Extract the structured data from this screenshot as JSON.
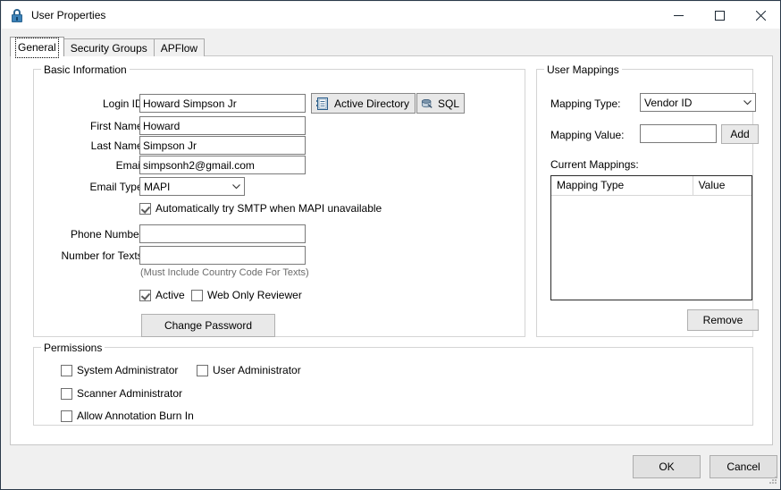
{
  "window": {
    "title": "User Properties",
    "icon": "lock-icon",
    "controls": {
      "minimize": "minimize-icon",
      "maximize": "maximize-icon",
      "close": "close-icon"
    }
  },
  "tabs": [
    {
      "label": "General",
      "selected": true
    },
    {
      "label": "Security Groups",
      "selected": false
    },
    {
      "label": "APFlow",
      "selected": false
    }
  ],
  "basic_information": {
    "title": "Basic Information",
    "fields": {
      "login_id_label": "Login ID:",
      "login_id_value": "Howard Simpson Jr",
      "first_name_label": "First Name:",
      "first_name_value": "Howard",
      "last_name_label": "Last Name:",
      "last_name_value": "Simpson Jr",
      "email_label": "Email:",
      "email_value": "simpsonh2@gmail.com",
      "email_type_label": "Email Type:",
      "email_type_value": "MAPI",
      "phone_number_label": "Phone Number:",
      "phone_number_value": "",
      "number_for_texts_label": "Number for Texts:",
      "number_for_texts_value": "",
      "country_code_hint": "(Must Include Country Code For Texts)"
    },
    "buttons": {
      "active_directory": "Active Directory",
      "sql": "SQL",
      "change_password": "Change Password"
    },
    "checkboxes": {
      "auto_smtp_label": "Automatically try SMTP when MAPI unavailable",
      "auto_smtp_checked": true,
      "active_label": "Active",
      "active_checked": true,
      "web_only_reviewer_label": "Web Only Reviewer",
      "web_only_reviewer_checked": false
    }
  },
  "user_mappings": {
    "title": "User Mappings",
    "mapping_type_label": "Mapping Type:",
    "mapping_type_value": "Vendor ID",
    "mapping_value_label": "Mapping Value:",
    "mapping_value_value": "",
    "add_button": "Add",
    "current_mappings_label": "Current Mappings:",
    "columns": [
      "Mapping Type",
      "Value"
    ],
    "rows": [],
    "remove_button": "Remove"
  },
  "permissions": {
    "title": "Permissions",
    "items": [
      {
        "label": "System Administrator",
        "checked": false
      },
      {
        "label": "User Administrator",
        "checked": false
      },
      {
        "label": "Scanner Administrator",
        "checked": false
      },
      {
        "label": "Allow Annotation Burn In",
        "checked": false
      }
    ]
  },
  "footer": {
    "ok": "OK",
    "cancel": "Cancel"
  },
  "colors": {
    "window_border": "#2b3a4a",
    "dialog_background": "#f0f0f0",
    "tab_body": "#ffffff",
    "accent_icon": "#3d82b8",
    "hint_text": "#6b6b6b"
  }
}
